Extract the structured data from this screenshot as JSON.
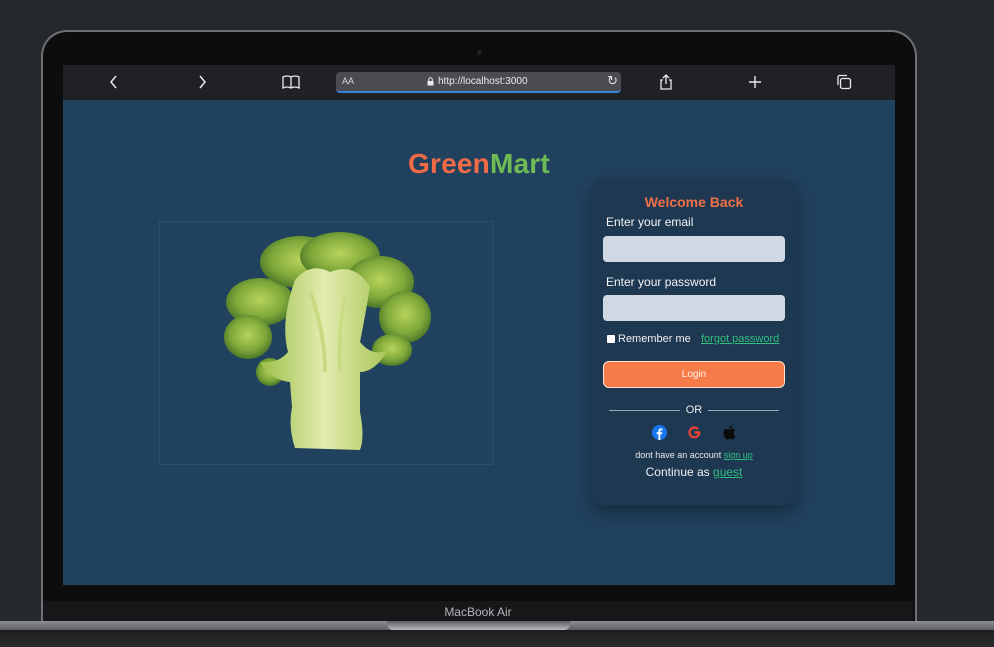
{
  "device": {
    "label": "MacBook Air"
  },
  "browser": {
    "text_size_label": "AA",
    "url": "http://localhost:3000",
    "icons": [
      "back-icon",
      "forward-icon",
      "bookmarks-icon",
      "lock-icon",
      "reload-icon",
      "share-icon",
      "new-tab-icon",
      "tabs-icon"
    ]
  },
  "brand": {
    "part1": "Green",
    "part2": "Mart",
    "colors": {
      "part1": "#f26b47",
      "part2": "#6fbc54"
    }
  },
  "hero": {
    "image": "broccoli-image"
  },
  "login": {
    "title": "Welcome Back",
    "email_label": "Enter your email",
    "email_value": "",
    "password_label": "Enter your password",
    "password_value": "",
    "remember_label": "Remember me",
    "forgot_label": "forgot password",
    "login_button": "Login",
    "divider": "OR",
    "social": [
      "facebook-icon",
      "google-icon",
      "apple-icon"
    ],
    "signup_prompt": "dont have an account",
    "signup_link": "sign up",
    "guest_prompt": "Continue as",
    "guest_link": "guest"
  },
  "colors": {
    "page_bg": "#21425f",
    "card_bg": "#1f3852",
    "accent": "#f57b48",
    "link": "#2fbf7f"
  }
}
